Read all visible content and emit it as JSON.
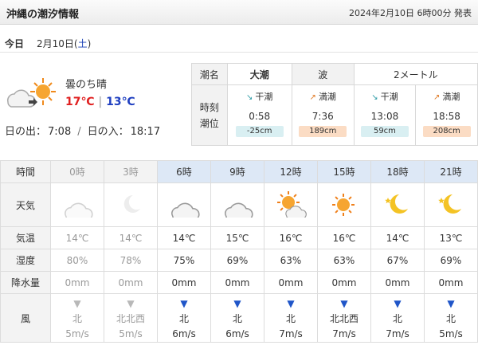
{
  "header": {
    "title": "沖縄の潮汐情報",
    "issued": "2024年2月10日 6時00分 発表"
  },
  "today": {
    "label": "今日",
    "date": "2月10日(",
    "weekday": "土",
    "date_end": ")"
  },
  "summary": {
    "weather": "曇のち晴",
    "high": "17℃",
    "low": "13℃",
    "sunrise_label": "日の出：",
    "sunrise": "7:08",
    "sunset_label": "日の入：",
    "sunset": "18:17"
  },
  "tide": {
    "tide_label": "潮名",
    "tide_name": "大潮",
    "wave_label": "波",
    "wave_value": "2メートル",
    "time_label": "時刻",
    "level_label": "潮位",
    "events": [
      {
        "kind": "干潮",
        "time": "0:58",
        "level": "-25cm",
        "type": "low"
      },
      {
        "kind": "満潮",
        "time": "7:36",
        "level": "189cm",
        "type": "high"
      },
      {
        "kind": "干潮",
        "time": "13:08",
        "level": "59cm",
        "type": "low"
      },
      {
        "kind": "満潮",
        "time": "18:58",
        "level": "208cm",
        "type": "high"
      }
    ]
  },
  "hourly": {
    "row_labels": {
      "time": "時間",
      "weather": "天気",
      "temp": "気温",
      "humidity": "湿度",
      "precip": "降水量",
      "wind": "風"
    },
    "hours": [
      {
        "time": "0時",
        "icon": "cloud-icon",
        "temp": "14℃",
        "humidity": "80%",
        "precip": "0mm",
        "wind_dir": "北",
        "wind_speed": "5m/s",
        "past": true
      },
      {
        "time": "3時",
        "icon": "moon-cloud-icon",
        "temp": "14℃",
        "humidity": "78%",
        "precip": "0mm",
        "wind_dir": "北北西",
        "wind_speed": "5m/s",
        "past": true
      },
      {
        "time": "6時",
        "icon": "cloud-icon",
        "temp": "14℃",
        "humidity": "75%",
        "precip": "0mm",
        "wind_dir": "北",
        "wind_speed": "6m/s",
        "past": false
      },
      {
        "time": "9時",
        "icon": "cloud-icon",
        "temp": "15℃",
        "humidity": "69%",
        "precip": "0mm",
        "wind_dir": "北",
        "wind_speed": "6m/s",
        "past": false
      },
      {
        "time": "12時",
        "icon": "sun-cloud-icon",
        "temp": "16℃",
        "humidity": "63%",
        "precip": "0mm",
        "wind_dir": "北",
        "wind_speed": "7m/s",
        "past": false
      },
      {
        "time": "15時",
        "icon": "sun-icon",
        "temp": "16℃",
        "humidity": "63%",
        "precip": "0mm",
        "wind_dir": "北北西",
        "wind_speed": "7m/s",
        "past": false
      },
      {
        "time": "18時",
        "icon": "moon-icon",
        "temp": "14℃",
        "humidity": "67%",
        "precip": "0mm",
        "wind_dir": "北",
        "wind_speed": "7m/s",
        "past": false
      },
      {
        "time": "21時",
        "icon": "moon-icon",
        "temp": "13℃",
        "humidity": "69%",
        "precip": "0mm",
        "wind_dir": "北",
        "wind_speed": "5m/s",
        "past": false
      }
    ]
  },
  "colors": {
    "high_temp": "#e02020",
    "low_temp": "#1f3fc0",
    "future_header": "#dde8f6",
    "wind_arrow": "#1f55c8"
  }
}
